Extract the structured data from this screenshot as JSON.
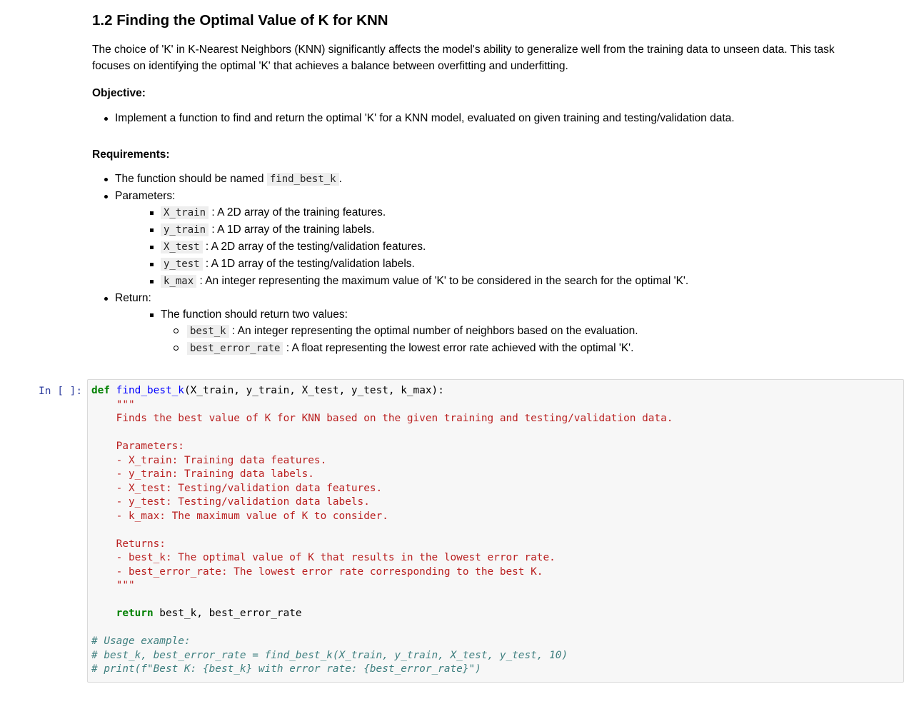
{
  "markdown": {
    "title": "1.2 Finding the Optimal Value of K for KNN",
    "intro_line1": "The choice of 'K' in K-Nearest Neighbors (KNN) significantly affects the model's ability to generalize well from the training data to unseen data. This task",
    "intro_line2": "focuses on identifying the optimal 'K' that achieves a balance between overfitting and underfitting.",
    "objective_heading": "Objective:",
    "objective_items": [
      "Implement a function to find and return the optimal 'K' for a KNN model, evaluated on given training and testing/validation data."
    ],
    "requirements_heading": "Requirements:",
    "req_name_prefix": "The function should be named ",
    "req_name_code": "find_best_k",
    "req_name_suffix": ".",
    "parameters_label": "Parameters:",
    "parameters": [
      {
        "code": "X_train",
        "desc": " : A 2D array of the training features."
      },
      {
        "code": "y_train",
        "desc": " : A 1D array of the training labels."
      },
      {
        "code": "X_test",
        "desc": " : A 2D array of the testing/validation features."
      },
      {
        "code": "y_test",
        "desc": " : A 1D array of the testing/validation labels."
      },
      {
        "code": "k_max",
        "desc": " : An integer representing the maximum value of 'K' to be considered in the search for the optimal 'K'."
      }
    ],
    "return_label": "Return:",
    "return_intro": "The function should return two values:",
    "returns": [
      {
        "code": "best_k",
        "desc": " : An integer representing the optimal number of neighbors based on the evaluation."
      },
      {
        "code": "best_error_rate",
        "desc": " : A float representing the lowest error rate achieved with the optimal 'K'."
      }
    ]
  },
  "code_cell": {
    "prompt": "In [ ]:",
    "def_kw": "def",
    "fn_name": "find_best_k",
    "signature": "(X_train, y_train, X_test, y_test, k_max):",
    "docstring": [
      "    \"\"\"",
      "    Finds the best value of K for KNN based on the given training and testing/validation data.",
      "",
      "    Parameters:",
      "    - X_train: Training data features.",
      "    - y_train: Training data labels.",
      "    - X_test: Testing/validation data features.",
      "    - y_test: Testing/validation data labels.",
      "    - k_max: The maximum value of K to consider.",
      "",
      "    Returns:",
      "    - best_k: The optimal value of K that results in the lowest error rate.",
      "    - best_error_rate: The lowest error rate corresponding to the best K.",
      "    \"\"\""
    ],
    "return_kw": "return",
    "return_values": " best_k, best_error_rate",
    "comments": [
      "# Usage example:",
      "# best_k, best_error_rate = find_best_k(X_train, y_train, X_test, y_test, 10)",
      "# print(f\"Best K: {best_k} with error rate: {best_error_rate}\")"
    ]
  }
}
